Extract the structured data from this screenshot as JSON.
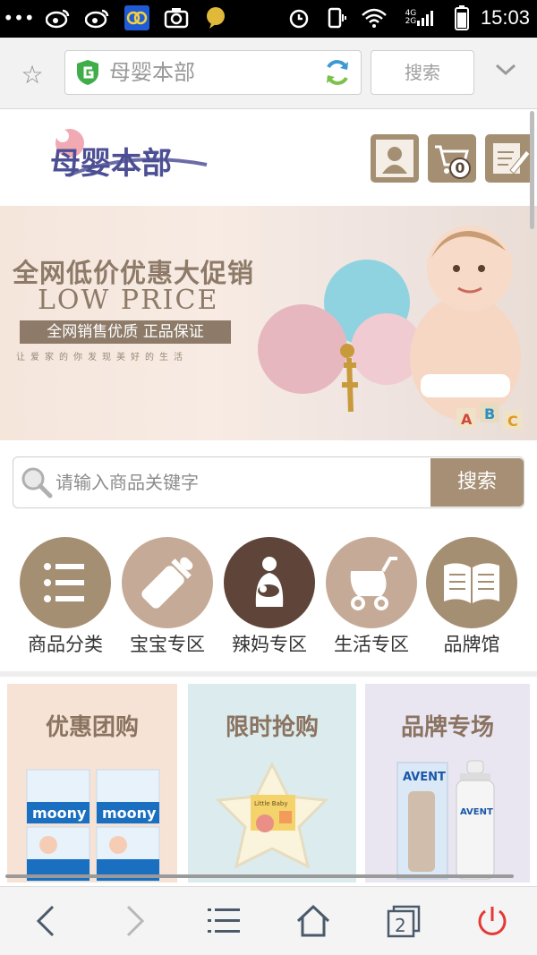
{
  "status_bar": {
    "time": "15:03",
    "network": "4G",
    "network2": "2G",
    "left_icons": [
      "more-dots-icon",
      "weibo-icon",
      "weibo-icon",
      "app-icon",
      "camera-icon",
      "chat-bubble-icon"
    ],
    "right_icons": [
      "alarm-icon",
      "vibrate-icon",
      "wifi-icon",
      "signal-icon",
      "battery-icon"
    ]
  },
  "browser": {
    "url_text": "母婴本部",
    "search_label": "搜索"
  },
  "site": {
    "logo_text": "母婴本部",
    "cart_count": "0"
  },
  "banner": {
    "headline": "全网低价优惠大促销",
    "subline": "LOW PRICE",
    "ribbon": "全网销售优质  正品保证",
    "tagline": "让爱家的你发现美好的生活",
    "blocks": [
      "A",
      "B",
      "C"
    ]
  },
  "search": {
    "placeholder": "请输入商品关键字",
    "button": "搜索"
  },
  "categories": [
    {
      "label": "商品分类",
      "color": "#a58f73"
    },
    {
      "label": "宝宝专区",
      "color": "#c5ab97"
    },
    {
      "label": "辣妈专区",
      "color": "#5f4539"
    },
    {
      "label": "生活专区",
      "color": "#c5ab97"
    },
    {
      "label": "品牌馆",
      "color": "#a58f73"
    }
  ],
  "promos": [
    {
      "title": "优惠团购",
      "product": "moony",
      "bg": "#f6e3d6"
    },
    {
      "title": "限时抢购",
      "product": "Little Baby",
      "bg": "#dcecee"
    },
    {
      "title": "品牌专场",
      "product": "AVENT",
      "bg": "#e9e6f2"
    }
  ],
  "colors": {
    "accent": "#a58f73",
    "accent_dark": "#5f4539",
    "accent_light": "#c5ab97",
    "power": "#e53935"
  },
  "bottom_nav": {
    "tab_count": "2",
    "icons": [
      "back-icon",
      "forward-icon",
      "menu-icon",
      "home-icon",
      "tabs-icon",
      "power-icon"
    ]
  }
}
